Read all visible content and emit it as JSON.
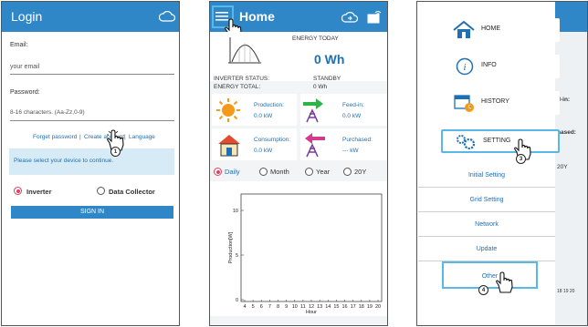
{
  "login": {
    "title": "Login",
    "email_label": "Email:",
    "email_placeholder": "your email",
    "password_label": "Password:",
    "password_placeholder": "8-16 characters. (Aa-Zz,0-9)",
    "forgot_password": "Forget password",
    "create_account": "Create account",
    "language": "Language",
    "separator": "|",
    "device_prompt": "Please select your device to continue.",
    "options": [
      "Inverter",
      "Data Collector"
    ],
    "sign_in": "SIGN IN",
    "step_badge": "1"
  },
  "home": {
    "title": "Home",
    "step_badge": "2",
    "energy_today_label": "ENERGY TODAY",
    "energy_today_value": "0 Wh",
    "inverter_status_label": "INVERTER STATUS:",
    "inverter_status_value": "STANDBY",
    "energy_total_label": "ENERGY TOTAL:",
    "energy_total_value": "0 Wh",
    "tiles": {
      "production": {
        "label": "Production:",
        "value": "0.0 kW"
      },
      "feed_in": {
        "label": "Feed-in:",
        "value": "0.0 kW"
      },
      "consumption": {
        "label": "Consumption:",
        "value": "0.0 kW"
      },
      "purchased": {
        "label": "Purchased:",
        "value": "--- kW"
      }
    },
    "periods": [
      "Daily",
      "Month",
      "Year",
      "20Y"
    ],
    "selected_period": "Daily",
    "colors": {
      "header": "#2f87c8",
      "sun": "#f39a1c",
      "feed_arrow": "#2db34a",
      "purchase_arrow": "#d63a8c",
      "selected": "#e04060"
    }
  },
  "chart_data": {
    "type": "line",
    "title": "",
    "xlabel": "Hour",
    "ylabel": "Production[W]",
    "x_ticks": [
      "4",
      "5",
      "6",
      "7",
      "8",
      "9",
      "10",
      "11",
      "12",
      "13",
      "14",
      "15",
      "16",
      "17",
      "18",
      "19",
      "20"
    ],
    "y_ticks": [
      "0",
      "5",
      "10"
    ],
    "xlim": [
      4,
      20
    ],
    "ylim": [
      0,
      10
    ],
    "series": [],
    "grid": false
  },
  "menu": {
    "items": [
      {
        "label": "HOME",
        "icon": "house-icon"
      },
      {
        "label": "INFO",
        "icon": "info-icon"
      },
      {
        "label": "HISTORY",
        "icon": "calendar-clock-icon"
      },
      {
        "label": "SETTING",
        "icon": "gears-icon"
      }
    ],
    "sub_items": [
      "Initial Setting",
      "Grid Setting",
      "Network",
      "Update",
      "Other"
    ],
    "step_badge_setting": "3",
    "step_badge_other": "4",
    "peek": {
      "feed_in": "d-in:",
      "purchased": "hased:",
      "period": "20Y",
      "axis": "18  19  20"
    }
  }
}
